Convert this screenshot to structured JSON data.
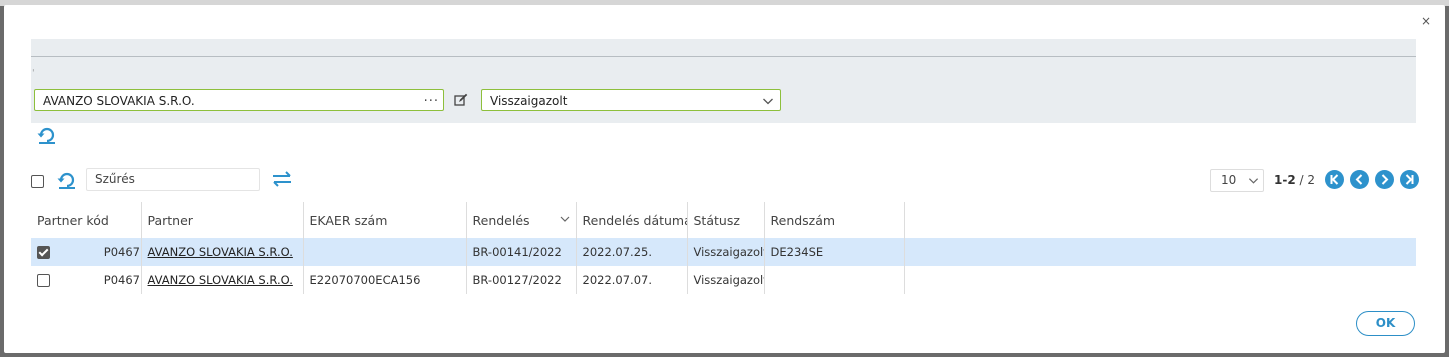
{
  "colors": {
    "accent": "#2d92cc",
    "field_border": "#8dbf3c",
    "selected_row": "#d6e8fb"
  },
  "dialog": {
    "close_label": "×"
  },
  "filters": {
    "partner_value": "AVANZO SLOVAKIA S.R.O.",
    "partner_more": "...",
    "status_value": "Visszaigazolt"
  },
  "toolbar": {
    "search_placeholder": "Szűrés",
    "page_size": "10",
    "page_range": "1-2",
    "page_total": "/ 2"
  },
  "table": {
    "columns": [
      "Partner kód",
      "Partner",
      "EKAER szám",
      "Rendelés",
      "Rendelés dátuma",
      "Státusz",
      "Rendszám"
    ],
    "rows": [
      {
        "checked": true,
        "partner_code": "P0467",
        "partner": "AVANZO SLOVAKIA S.R.O.",
        "ekaer": "",
        "order": "BR-00141/2022",
        "order_date": "2022.07.25.",
        "status": "Visszaigazolt",
        "plate": "DE234SE"
      },
      {
        "checked": false,
        "partner_code": "P0467",
        "partner": "AVANZO SLOVAKIA S.R.O.",
        "ekaer": "E22070700ECA156",
        "order": "BR-00127/2022",
        "order_date": "2022.07.07.",
        "status": "Visszaigazolt",
        "plate": ""
      }
    ]
  },
  "footer": {
    "ok_label": "OK"
  }
}
